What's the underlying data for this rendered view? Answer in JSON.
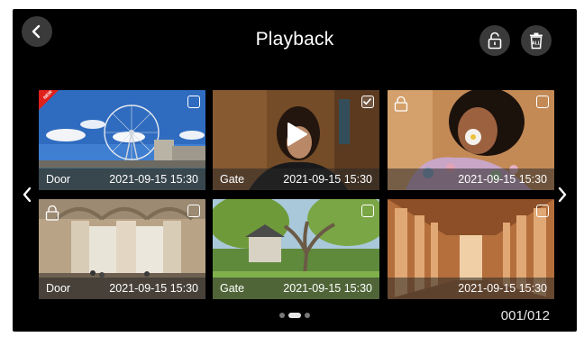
{
  "header": {
    "title": "Playback",
    "back_icon": "chevron-left-icon",
    "lock_icon": "lock-icon",
    "delete_all_icon": "trash-all-icon",
    "delete_all_text": "ALL"
  },
  "thumbnails": [
    {
      "location": "Door",
      "datetime": "2021-09-15 15:30",
      "badge": "NEW",
      "checked": false,
      "locked": false,
      "selected": false,
      "scene": "city-ferris-wheel"
    },
    {
      "location": "Gate",
      "datetime": "2021-09-15 15:30",
      "badge": "",
      "checked": true,
      "locked": false,
      "selected": true,
      "scene": "woman-video"
    },
    {
      "location": "",
      "datetime": "2021-09-15 15:30",
      "badge": "",
      "checked": false,
      "locked": true,
      "selected": false,
      "scene": "woman-flower"
    },
    {
      "location": "Door",
      "datetime": "2021-09-15 15:30",
      "badge": "",
      "checked": false,
      "locked": true,
      "selected": false,
      "scene": "courtyard-columns"
    },
    {
      "location": "Gate",
      "datetime": "2021-09-15 15:30",
      "badge": "",
      "checked": false,
      "locked": false,
      "selected": false,
      "scene": "tree-house"
    },
    {
      "location": "",
      "datetime": "2021-09-15 15:30",
      "badge": "",
      "checked": false,
      "locked": false,
      "selected": false,
      "scene": "colonnade-corridor"
    }
  ],
  "pagination": {
    "counter": "001/012",
    "pages": 3,
    "active_page": 2
  },
  "colors": {
    "background": "#000000",
    "selected_border": "#e3c27a",
    "new_badge": "#e0201b"
  }
}
